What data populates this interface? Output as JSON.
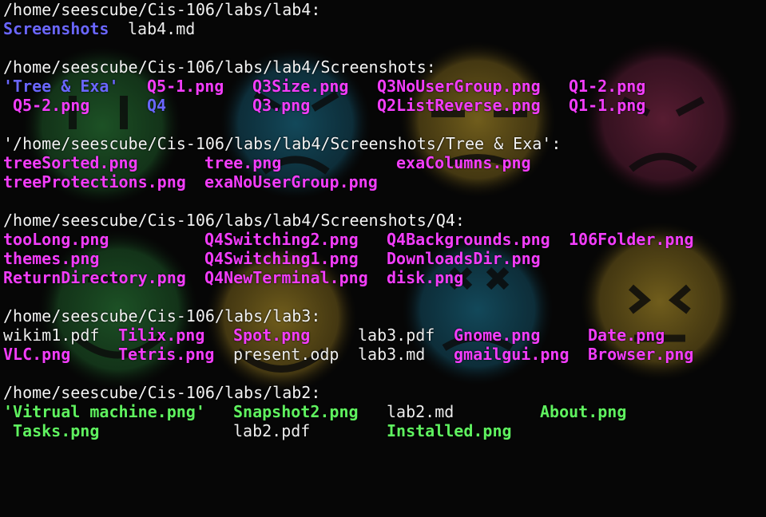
{
  "colors": {
    "background": "#060606",
    "directory": "#6a66ff",
    "image_file": "#f23dfa",
    "green_file": "#5ff25f",
    "plain_text": "#ededed"
  },
  "wallpaper": {
    "faces": [
      {
        "icon": "neutral-face-icon",
        "color": "#2f8f3f"
      },
      {
        "icon": "sad-face-icon",
        "color": "#1d6f8f"
      },
      {
        "icon": "frown-face-icon",
        "color": "#b89a2a"
      },
      {
        "icon": "angry-face-icon",
        "color": "#8a2a4a"
      },
      {
        "icon": "smile-face-icon",
        "color": "#2f8f3f"
      },
      {
        "icon": "smile-face-icon",
        "color": "#b89a2a"
      },
      {
        "icon": "dead-face-icon",
        "color": "#1d6f8f"
      },
      {
        "icon": "squint-face-icon",
        "color": "#b89a2a"
      }
    ]
  },
  "listing": {
    "lab4": {
      "header": "/home/seescube/Cis-106/labs/lab4:",
      "row1": {
        "screenshots_dir": "Screenshots",
        "lab4_md": "lab4.md"
      }
    },
    "screenshots": {
      "header": "/home/seescube/Cis-106/labs/lab4/Screenshots:",
      "row1": [
        "'Tree & Exa'",
        "Q5-1.png",
        "Q3Size.png",
        "Q3NoUserGroup.png",
        "Q1-2.png"
      ],
      "row2": [
        "Q5-2.png",
        "Q4",
        "Q3.png",
        "Q2ListReverse.png",
        "Q1-1.png"
      ]
    },
    "tree": {
      "header": "'/home/seescube/Cis-106/labs/lab4/Screenshots/Tree & Exa':",
      "row1": [
        "treeSorted.png",
        "tree.png",
        "exaColumns.png"
      ],
      "row2": [
        "treeProtections.png",
        "exaNoUserGroup.png"
      ]
    },
    "q4": {
      "header": "/home/seescube/Cis-106/labs/lab4/Screenshots/Q4:",
      "row1": [
        "tooLong.png",
        "Q4Switching2.png",
        "Q4Backgrounds.png",
        "106Folder.png"
      ],
      "row2": [
        "themes.png",
        "Q4Switching1.png",
        "DownloadsDir.png"
      ],
      "row3": [
        "ReturnDirectory.png",
        "Q4NewTerminal.png",
        "disk.png"
      ]
    },
    "lab3": {
      "header": "/home/seescube/Cis-106/labs/lab3:",
      "row1": [
        "wikim1.pdf",
        "Tilix.png",
        "Spot.png",
        "lab3.pdf",
        "Gnome.png",
        "Date.png"
      ],
      "row2": [
        "VLC.png",
        "Tetris.png",
        "present.odp",
        "lab3.md",
        "gmailgui.png",
        "Browser.png"
      ]
    },
    "lab2": {
      "header": "/home/seescube/Cis-106/labs/lab2:",
      "row1": [
        "'Vitrual machine.png'",
        "Snapshot2.png",
        "lab2.md",
        "About.png"
      ],
      "row2": [
        "Tasks.png",
        "lab2.pdf",
        "Installed.png"
      ]
    }
  }
}
